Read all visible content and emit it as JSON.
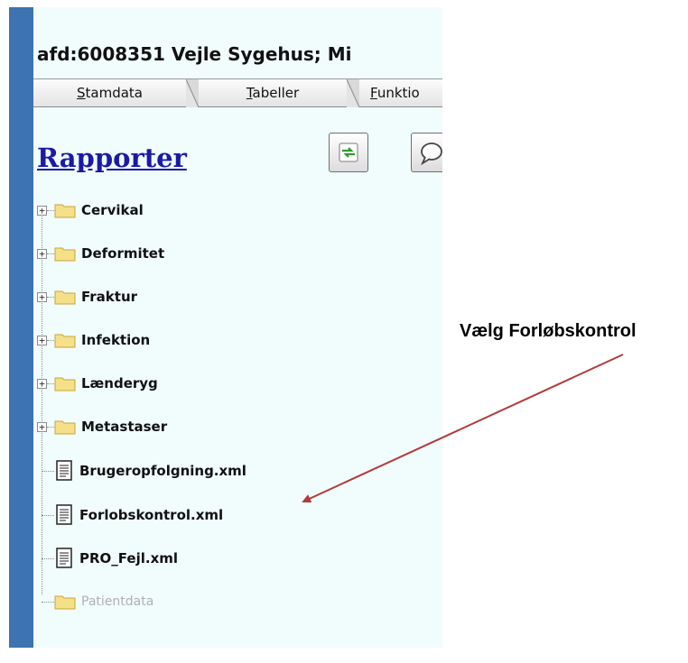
{
  "header": {
    "department": "afd:6008351 Vejle Sygehus; Mi"
  },
  "tabs": [
    {
      "label_mnemonic": "S",
      "label_rest": "tamdata"
    },
    {
      "label_mnemonic": "T",
      "label_rest": "abeller"
    },
    {
      "label_mnemonic": "F",
      "label_rest": "unktio"
    }
  ],
  "section_title": "Rapporter",
  "toolbar": {
    "buttons": [
      {
        "icon": "refresh-icon"
      },
      {
        "icon": "comment-icon"
      }
    ]
  },
  "tree": {
    "folders": [
      {
        "label": "Cervikal",
        "expander": "+"
      },
      {
        "label": "Deformitet",
        "expander": "+"
      },
      {
        "label": "Fraktur",
        "expander": "+"
      },
      {
        "label": "Infektion",
        "expander": "+"
      },
      {
        "label": "Lænderyg",
        "expander": "+"
      },
      {
        "label": "Metastaser",
        "expander": "+"
      }
    ],
    "files": [
      {
        "label": "Brugeropfolgning.xml"
      },
      {
        "label": "Forlobskontrol.xml"
      },
      {
        "label": "PRO_Fejl.xml"
      }
    ],
    "disabled_folder": {
      "label": "Patientdata"
    }
  },
  "annotation": {
    "text": "Vælg Forløbskontrol"
  },
  "colors": {
    "sidebar": "#3d73b0",
    "panel": "#f1fcfd",
    "link": "#1a1aa6",
    "arrow": "#b23a3a",
    "folder": "#f5e08a"
  }
}
